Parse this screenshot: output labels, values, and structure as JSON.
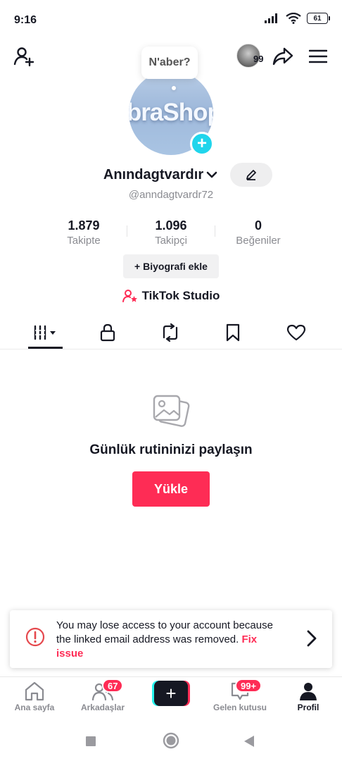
{
  "status_bar": {
    "time": "9:16",
    "battery": "61"
  },
  "top_bar": {
    "story_count": "99"
  },
  "bubble": {
    "text": "N'aber?"
  },
  "avatar": {
    "text": "ibraShop"
  },
  "profile": {
    "display_name": "Anındagtvardır",
    "handle": "@anndagtvardr72"
  },
  "stats": [
    {
      "value": "1.879",
      "label": "Takipte"
    },
    {
      "value": "1.096",
      "label": "Takipçi"
    },
    {
      "value": "0",
      "label": "Beğeniler"
    }
  ],
  "bio_button": {
    "label": "+ Biyografi ekle"
  },
  "studio": {
    "label": "TikTok Studio"
  },
  "empty_state": {
    "title": "Günlük rutininizi paylaşın",
    "upload_label": "Yükle"
  },
  "warning": {
    "text": "You may lose access to your account because the linked email address was removed.",
    "link": "Fix issue"
  },
  "bottom_nav": {
    "home": "Ana sayfa",
    "friends": "Arkadaşlar",
    "friends_badge": "67",
    "inbox": "Gelen kutusu",
    "inbox_badge": "99+",
    "profile": "Profil"
  },
  "colors": {
    "accent": "#fe2c55",
    "cyan": "#25f4ee",
    "plus": "#20d5ec"
  }
}
